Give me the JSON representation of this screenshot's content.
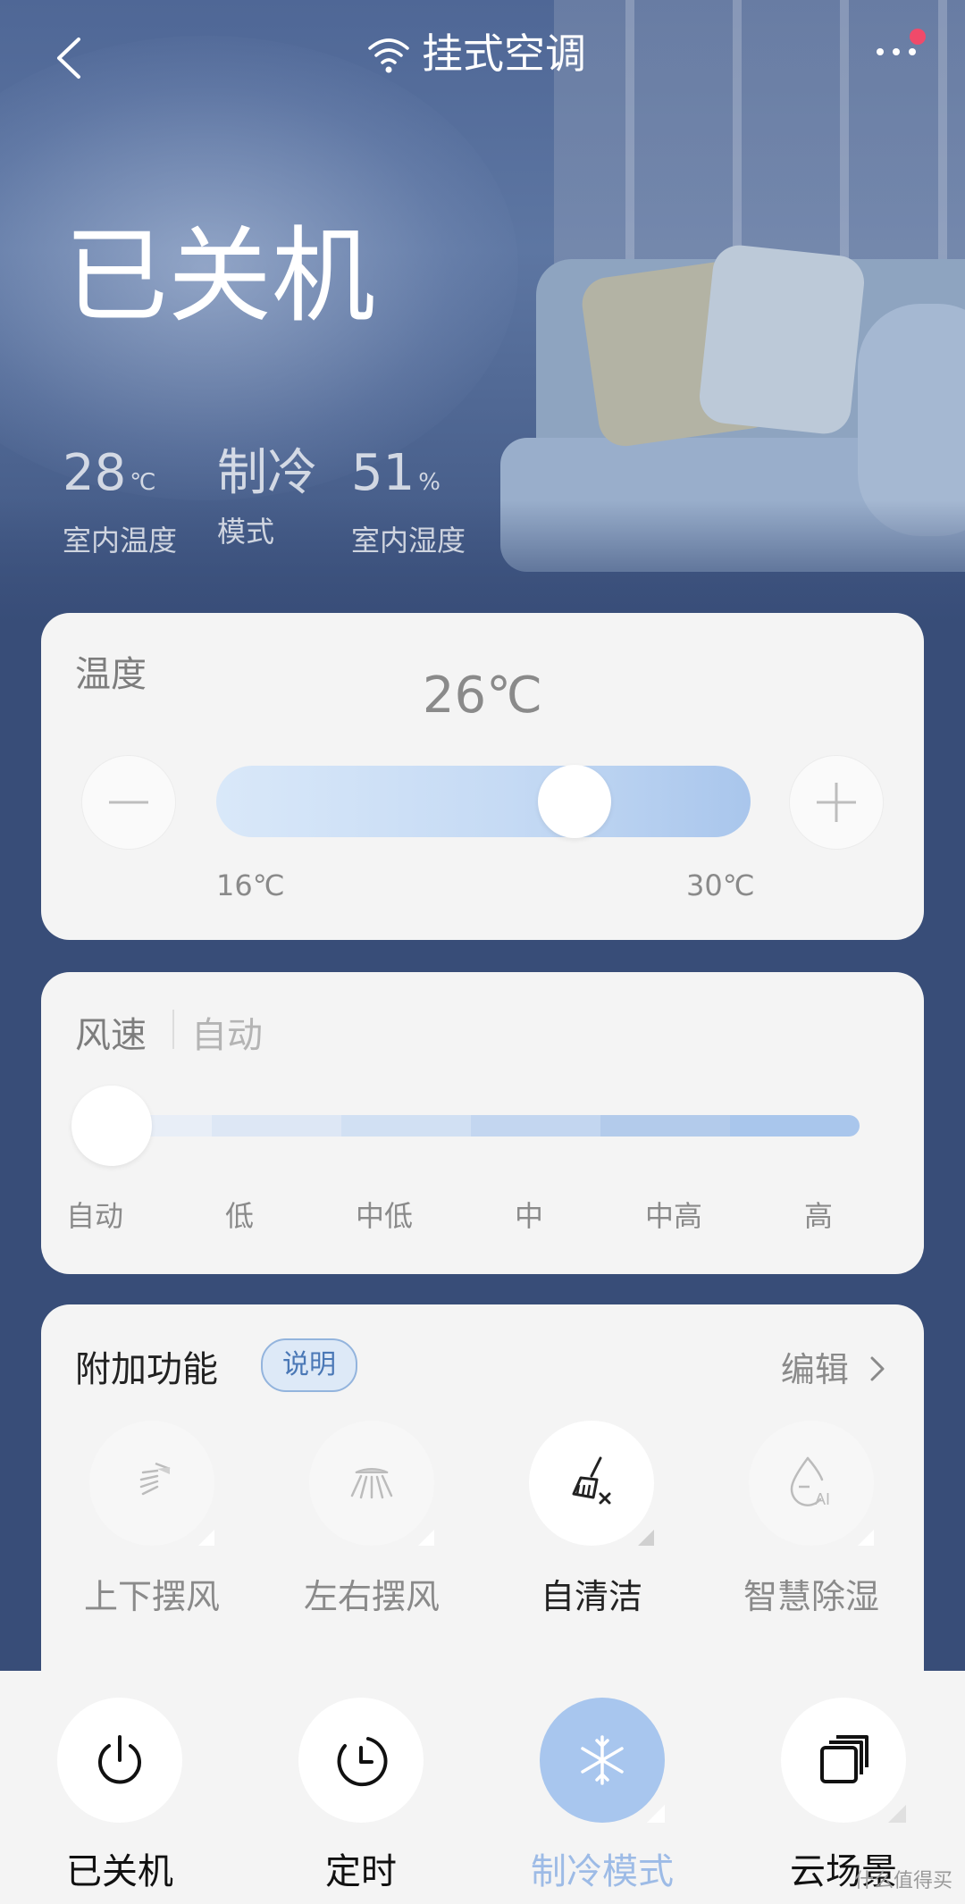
{
  "header": {
    "title": "挂式空调"
  },
  "status": {
    "power_state": "已关机",
    "indoor_temp": {
      "value": "28",
      "unit": "℃",
      "label": "室内温度"
    },
    "mode": {
      "value": "制冷",
      "label": "模式"
    },
    "humidity": {
      "value": "51",
      "unit": "%",
      "label": "室内湿度"
    }
  },
  "temperature_card": {
    "title": "温度",
    "current": "26℃",
    "min_label": "16℃",
    "max_label": "30℃",
    "setpoint": 26,
    "min": 16,
    "max": 30
  },
  "fan_card": {
    "title": "风速",
    "current": "自动",
    "levels": [
      "自动",
      "低",
      "中低",
      "中",
      "中高",
      "高"
    ],
    "selected_index": 0
  },
  "extras_card": {
    "title": "附加功能",
    "badge": "说明",
    "edit_label": "编辑",
    "features": [
      {
        "label": "上下摆风",
        "icon": "vertical-swing-icon",
        "active": false
      },
      {
        "label": "左右摆风",
        "icon": "horizontal-swing-icon",
        "active": false
      },
      {
        "label": "自清洁",
        "icon": "self-clean-icon",
        "active": true
      },
      {
        "label": "智慧除湿",
        "icon": "ai-dehumidify-icon",
        "active": false
      }
    ]
  },
  "bottom_bar": [
    {
      "label": "已关机",
      "icon": "power-icon"
    },
    {
      "label": "定时",
      "icon": "timer-icon"
    },
    {
      "label": "制冷模式",
      "icon": "snowflake-icon"
    },
    {
      "label": "云场景",
      "icon": "cloud-scene-icon"
    }
  ],
  "watermark": "什么值得买",
  "colors": {
    "accent": "#a8c6ee",
    "background": "#384d78",
    "card": "#f4f4f4",
    "notify": "#f04a6a"
  }
}
